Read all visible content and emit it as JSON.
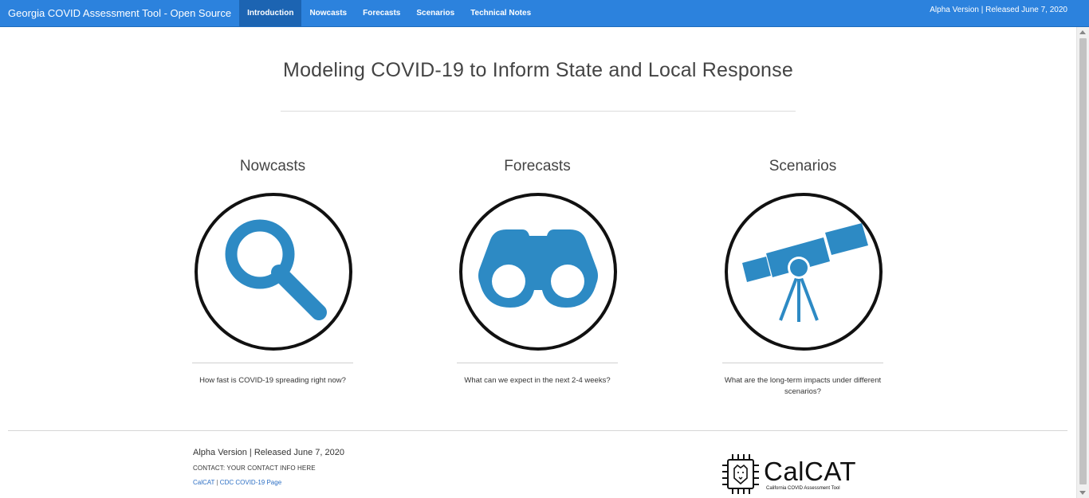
{
  "navbar": {
    "brand": "Georgia COVID Assessment Tool - Open Source",
    "items": [
      {
        "label": "Introduction",
        "active": true
      },
      {
        "label": "Nowcasts",
        "active": false
      },
      {
        "label": "Forecasts",
        "active": false
      },
      {
        "label": "Scenarios",
        "active": false
      },
      {
        "label": "Technical Notes",
        "active": false
      }
    ],
    "version_text": "Alpha Version | Released June 7, 2020"
  },
  "main": {
    "title": "Modeling COVID-19 to Inform State and Local Response",
    "cards": [
      {
        "heading": "Nowcasts",
        "icon": "magnifier-icon",
        "text": "How fast is COVID-19 spreading right now?"
      },
      {
        "heading": "Forecasts",
        "icon": "binoculars-icon",
        "text": "What can we expect in the next 2-4 weeks?"
      },
      {
        "heading": "Scenarios",
        "icon": "telescope-icon",
        "text": "What are the long-term impacts under different scenarios?"
      }
    ]
  },
  "footer": {
    "version": "Alpha Version | Released June 7, 2020",
    "contact": "CONTACT: YOUR CONTACT INFO HERE",
    "links": [
      {
        "label": "CalCAT"
      },
      {
        "label": "CDC COVID-19 Page"
      }
    ],
    "link_separator": " | ",
    "logo": {
      "wordmark": "CalCAT",
      "subtitle": "California COVID Assessment Tool"
    }
  },
  "colors": {
    "navbar": "#2c82dd",
    "navbar_active": "#1c64b2",
    "icon_blue": "#2d8ac4",
    "link": "#2c6fc4"
  }
}
